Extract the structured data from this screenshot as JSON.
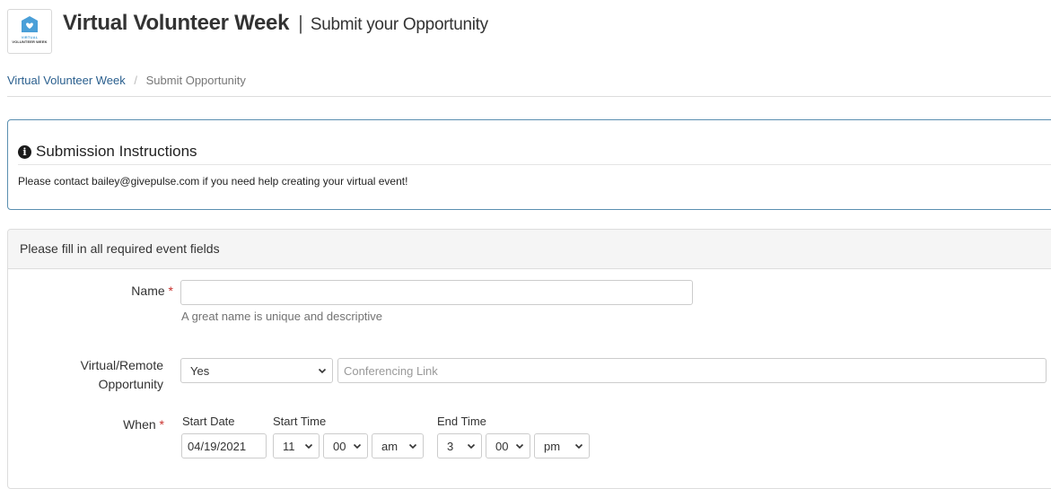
{
  "header": {
    "logo_line1": "VIRTUAL",
    "logo_line2": "VOLUNTEER WEEK",
    "site_title": "Virtual Volunteer Week",
    "separator": "|",
    "page_subtitle": "Submit your Opportunity"
  },
  "breadcrumb": {
    "home": "Virtual Volunteer Week",
    "separator": "/",
    "current": "Submit Opportunity"
  },
  "instructions": {
    "title": "Submission Instructions",
    "text": "Please contact bailey@givepulse.com if you need help creating your virtual event!"
  },
  "form": {
    "heading": "Please fill in all required event fields",
    "required_mark": "*",
    "name": {
      "label": "Name",
      "value": "",
      "help": "A great name is unique and descriptive"
    },
    "virtual": {
      "label_line1": "Virtual/Remote",
      "label_line2": "Opportunity",
      "selected": "Yes",
      "link_placeholder": "Conferencing Link"
    },
    "when": {
      "label": "When",
      "start_date_label": "Start Date",
      "start_time_label": "Start Time",
      "end_time_label": "End Time",
      "start_date": "04/19/2021",
      "start_hour": "11",
      "start_minute": "00",
      "start_ampm": "am",
      "end_hour": "3",
      "end_minute": "00",
      "end_ampm": "pm"
    }
  },
  "colors": {
    "link": "#2a5f8e",
    "required": "#c9302c",
    "info_border": "#5a8fb0",
    "logo_blue": "#4a9fd8"
  }
}
